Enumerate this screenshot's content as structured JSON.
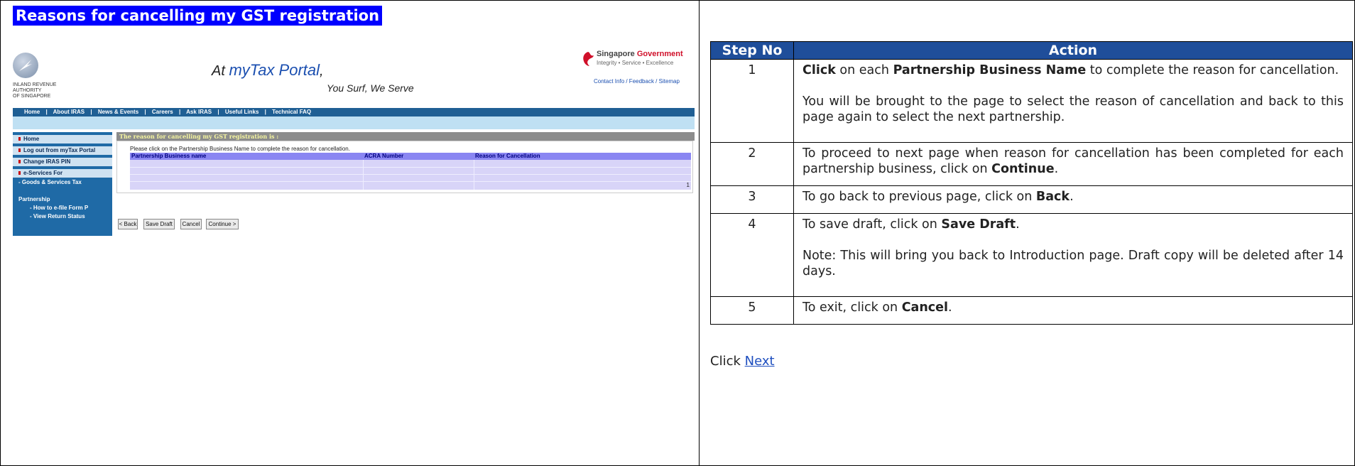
{
  "left": {
    "title": "Reasons for cancelling my GST registration",
    "portal": {
      "logo_lines": "INLAND REVENUE\nAUTHORITY\nOF SINGAPORE",
      "tagline_at": "At",
      "tagline_my": "myTax Portal",
      "tagline_comma": ",",
      "tagline_sub": "You Surf, We Serve",
      "sg_title": "Singapore",
      "sg_gov": "Government",
      "sg_sub": "Integrity • Service • Excellence",
      "contact": "Contact Info / Feedback / Sitemap",
      "topnav": [
        "Home",
        "|",
        "About IRAS",
        "|",
        "News & Events",
        "|",
        "Careers",
        "|",
        "Ask IRAS",
        "|",
        "Useful Links",
        "|",
        "Technical FAQ"
      ],
      "sidebar": {
        "home": "Home",
        "logout": "Log out from myTax Portal",
        "change_pin": "Change IRAS PIN",
        "eservices": "e-Services For",
        "gst": "- Goods & Services Tax",
        "partnership": "Partnership",
        "efile": "- How to e-file Form P",
        "view_status": "- View Return Status"
      },
      "content_heading": "The reason for cancelling my GST registration is :",
      "instruction": "Please click on the Partnership Business Name to complete the reason for cancellation.",
      "table_headers": [
        "Partnership Business name",
        "ACRA Number",
        "Reason for Cancellation"
      ],
      "page_number": "1",
      "buttons": {
        "back": "< Back",
        "save_draft": "Save Draft",
        "cancel": "Cancel",
        "continue": "Continue >"
      }
    }
  },
  "right": {
    "headers": {
      "step": "Step No",
      "action": "Action"
    },
    "steps": [
      {
        "no": "1"
      },
      {
        "no": "2"
      },
      {
        "no": "3"
      },
      {
        "no": "4"
      },
      {
        "no": "5"
      }
    ],
    "text": {
      "s1_click": "Click",
      "s1_a": " on each ",
      "s1_pbn": "Partnership Business Name",
      "s1_b": " to complete the reason for cancellation.",
      "s1_p2": "You will be brought to the page to select the reason of cancellation and back to this page again to select the next partnership.",
      "s2_a": "To proceed to next page when reason for cancellation has been completed for each partnership business, click on ",
      "s2_continue": "Continue",
      "s3_a": "To go back to previous page, click on ",
      "s3_back": "Back",
      "s4_a": "To save draft, click on ",
      "s4_save": "Save Draft",
      "s4_note": "Note: This will bring you back to Introduction page. Draft copy will be deleted after 14 days.",
      "s5_a": "To exit, click on ",
      "s5_cancel": "Cancel",
      "period": "."
    },
    "click_label": "Click ",
    "next_link": "Next"
  }
}
